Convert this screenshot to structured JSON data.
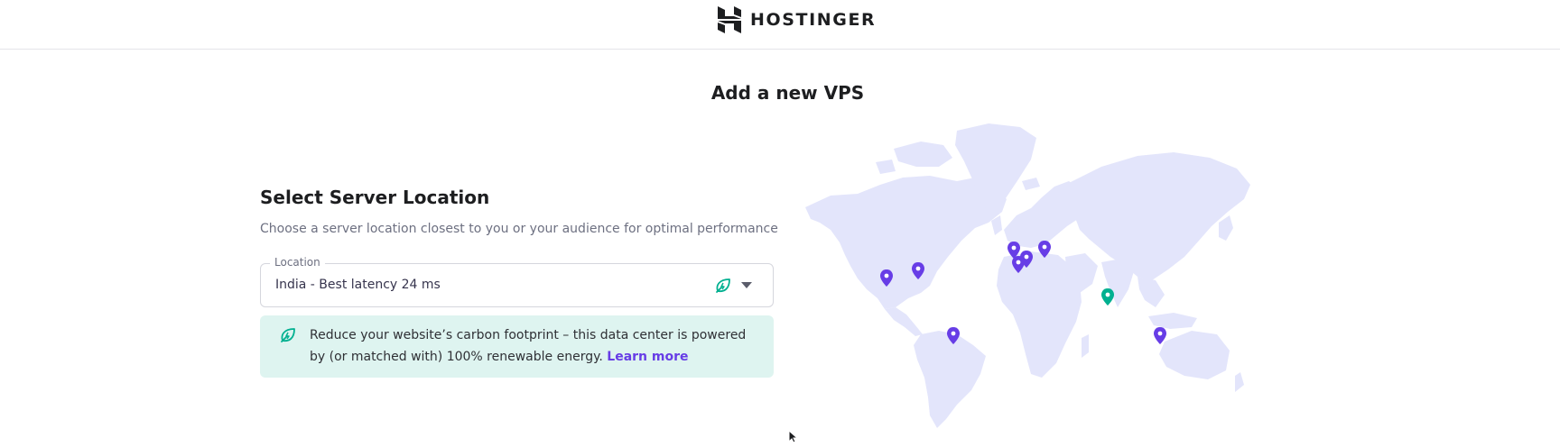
{
  "header": {
    "brand": "HOSTINGER",
    "logo_icon": "hostinger-logo-icon"
  },
  "page": {
    "title": "Add a new VPS"
  },
  "server_location": {
    "title": "Select Server Location",
    "subtitle": "Choose a server location closest to you or your audience for optimal performance",
    "select": {
      "label": "Location",
      "value": "India - Best latency 24 ms",
      "icons": [
        "leaf-icon",
        "caret-down-icon"
      ]
    },
    "eco_banner": {
      "icon": "leaf-icon",
      "text": "Reduce your website’s carbon footprint – this data center is powered by (or matched with) 100% renewable energy.",
      "link": "Learn more"
    }
  },
  "map": {
    "land_color": "#e3e5fb",
    "pin_color": "#673de6",
    "selected_pin_color": "#00b090",
    "pins": [
      {
        "location": "us-west",
        "selected": false
      },
      {
        "location": "us-east",
        "selected": false
      },
      {
        "location": "brazil",
        "selected": false
      },
      {
        "location": "uk",
        "selected": false
      },
      {
        "location": "france",
        "selected": false
      },
      {
        "location": "netherlands",
        "selected": false
      },
      {
        "location": "lithuania",
        "selected": false
      },
      {
        "location": "india",
        "selected": true
      },
      {
        "location": "singapore",
        "selected": false
      }
    ]
  },
  "colors": {
    "accent": "#673de6",
    "eco_green": "#00b090",
    "eco_bg": "#def4f0"
  }
}
